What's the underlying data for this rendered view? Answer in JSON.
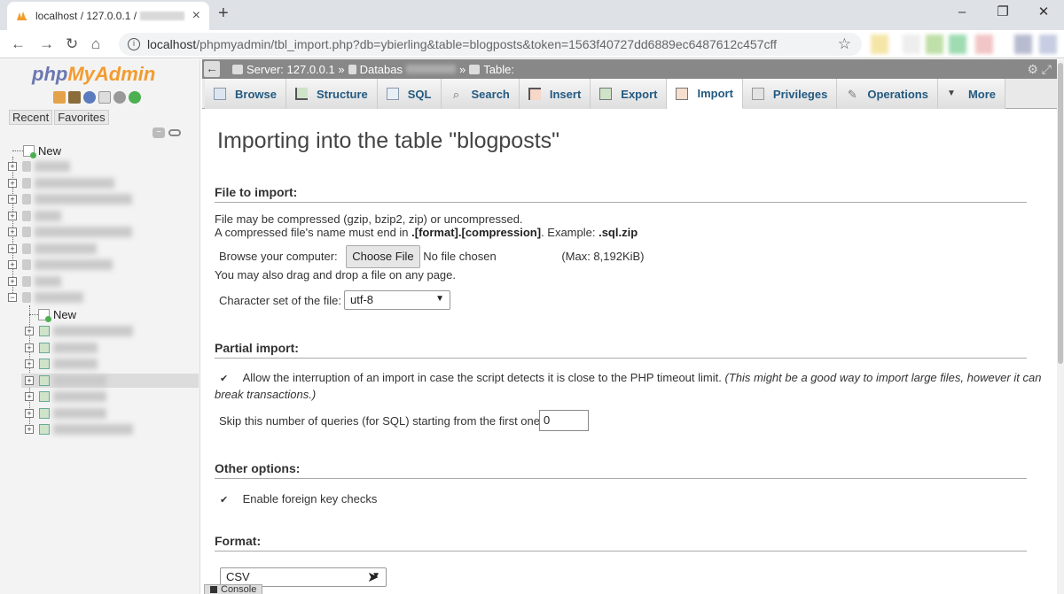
{
  "browser": {
    "tab_title": "localhost / 127.0.0.1 /",
    "url_host": "localhost",
    "url_path": "/phpmyadmin/tbl_import.php?db=ybierling&table=blogposts&token=1563f40727dd6889ec6487612c457cff",
    "window_controls": [
      "–",
      "❐",
      "✕"
    ]
  },
  "sidebar": {
    "logo_php": "php",
    "logo_myadmin": "MyAdmin",
    "tabs": [
      "Recent",
      "Favorites"
    ],
    "new_label": "New",
    "db_new_label": "New"
  },
  "breadcrumb": {
    "server": "Server: 127.0.0.1 »",
    "database": "Databas",
    "sep": "»",
    "table": "Table:"
  },
  "tabs": [
    {
      "label": "Browse",
      "icon": "browse-icon"
    },
    {
      "label": "Structure",
      "icon": "structure-icon"
    },
    {
      "label": "SQL",
      "icon": "sql-icon"
    },
    {
      "label": "Search",
      "icon": "search-icon"
    },
    {
      "label": "Insert",
      "icon": "insert-icon"
    },
    {
      "label": "Export",
      "icon": "export-icon"
    },
    {
      "label": "Import",
      "icon": "import-icon",
      "active": true
    },
    {
      "label": "Privileges",
      "icon": "privileges-icon"
    },
    {
      "label": "Operations",
      "icon": "operations-icon"
    },
    {
      "label": "More",
      "icon": "chevron-down-icon"
    }
  ],
  "page": {
    "title": "Importing into the table \"blogposts\"",
    "file_section": "File to import:",
    "compress_line1": "File may be compressed (gzip, bzip2, zip) or uncompressed.",
    "compress_line2_pre": "A compressed file's name must end in ",
    "compress_line2_bold": ".[format].[compression]",
    "compress_line2_mid": ". Example: ",
    "compress_line2_example": ".sql.zip",
    "browse_label": "Browse your computer:",
    "choose_file": "Choose File",
    "no_file": "No file chosen",
    "max_size": "(Max: 8,192KiB)",
    "drag_drop": "You may also drag and drop a file on any page.",
    "charset_label": "Character set of the file:",
    "charset_value": "utf-8",
    "partial_section": "Partial import:",
    "allow_interrupt": "Allow the interruption of an import in case the script detects it is close to the PHP timeout limit.",
    "allow_interrupt_note": "(This might be a good way to import large files, however it can",
    "allow_interrupt_note2": "break transactions.)",
    "skip_label": "Skip this number of queries (for SQL) starting from the first one:",
    "skip_value": "0",
    "other_section": "Other options:",
    "foreign_key": "Enable foreign key checks",
    "format_section": "Format:",
    "format_value": "CSV",
    "console_label": "Console"
  }
}
